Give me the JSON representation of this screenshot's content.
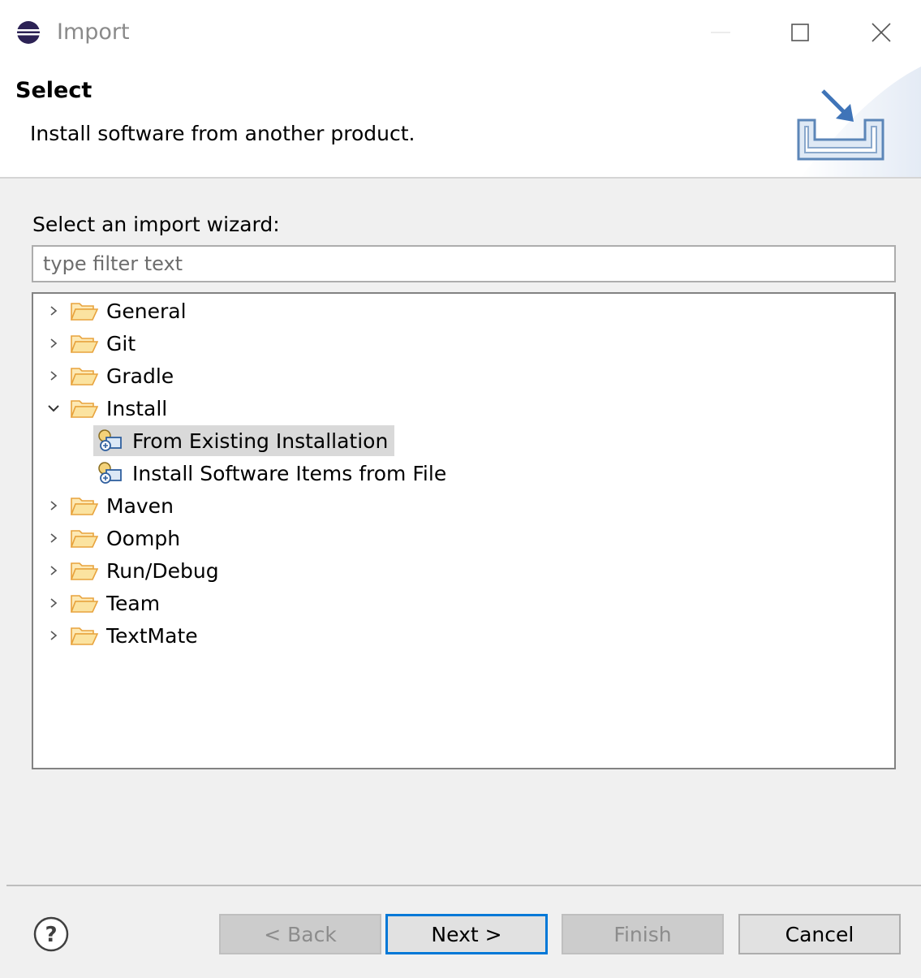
{
  "window": {
    "title": "Import",
    "icons": {
      "app": "eclipse-icon",
      "minimize": "minimize-icon",
      "maximize": "maximize-icon",
      "close": "close-icon"
    }
  },
  "header": {
    "title": "Select",
    "description": "Install software from another product.",
    "banner_icon": "import-wizard-icon"
  },
  "main": {
    "wizard_label": "Select an import wizard:",
    "filter": {
      "value": "",
      "placeholder": "type filter text"
    },
    "tree": [
      {
        "label": "General",
        "expanded": false
      },
      {
        "label": "Git",
        "expanded": false
      },
      {
        "label": "Gradle",
        "expanded": false
      },
      {
        "label": "Install",
        "expanded": true,
        "children": [
          {
            "label": "From Existing Installation",
            "selected": true
          },
          {
            "label": "Install Software Items from File",
            "selected": false
          }
        ]
      },
      {
        "label": "Maven",
        "expanded": false
      },
      {
        "label": "Oomph",
        "expanded": false
      },
      {
        "label": "Run/Debug",
        "expanded": false
      },
      {
        "label": "Team",
        "expanded": false
      },
      {
        "label": "TextMate",
        "expanded": false
      }
    ]
  },
  "footer": {
    "help_icon": "help-icon",
    "back_label": "< Back",
    "next_label": "Next >",
    "finish_label": "Finish",
    "cancel_label": "Cancel"
  },
  "colors": {
    "selection": "#d9d9d9",
    "default_button_border": "#0078d7",
    "folder": "#e8a33d",
    "background": "#f0f0f0"
  }
}
